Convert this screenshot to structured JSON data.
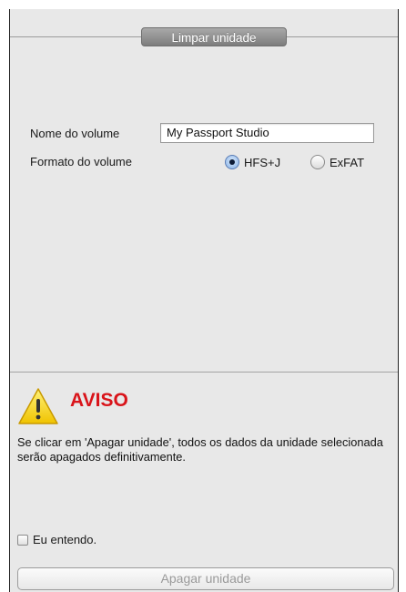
{
  "header": {
    "title": "Limpar unidade"
  },
  "form": {
    "volume_name_label": "Nome do volume",
    "volume_name_value": "My Passport Studio",
    "volume_format_label": "Formato do volume",
    "format_options": [
      {
        "label": "HFS+J",
        "selected": true
      },
      {
        "label": "ExFAT",
        "selected": false
      }
    ]
  },
  "warning": {
    "title": "AVISO",
    "message": "Se clicar em 'Apagar unidade', todos os dados da unidade selecionada serão apagados definitivamente.",
    "icon": "warning-triangle-icon",
    "title_color": "#d9141a"
  },
  "confirm": {
    "label": "Eu entendo.",
    "checked": false
  },
  "actions": {
    "erase_label": "Apagar unidade",
    "erase_enabled": false
  }
}
